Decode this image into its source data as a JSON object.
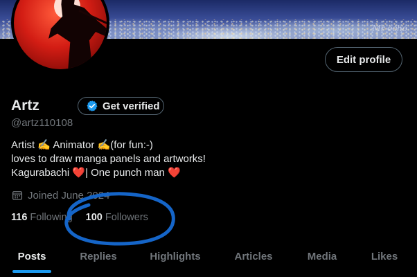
{
  "banner": {
    "signature": "Mr echo"
  },
  "profile": {
    "name": "Artz",
    "handle": "@artz110108",
    "get_verified_label": "Get verified",
    "edit_profile_label": "Edit profile",
    "bio_lines": [
      "Artist ✍️ Animator ✍️(for fun:-)",
      "loves to draw manga panels and artworks!",
      "Kagurabachi ❤️| One punch man ❤️"
    ],
    "joined": "Joined June 2024",
    "following_count": "116",
    "following_label": "Following",
    "followers_count": "100",
    "followers_label": "Followers"
  },
  "tabs": [
    {
      "label": "Posts",
      "active": true
    },
    {
      "label": "Replies",
      "active": false
    },
    {
      "label": "Highlights",
      "active": false
    },
    {
      "label": "Articles",
      "active": false
    },
    {
      "label": "Media",
      "active": false
    },
    {
      "label": "Likes",
      "active": false
    }
  ],
  "colors": {
    "accent": "#1d9bf0",
    "annotation": "#1565c8",
    "heart": "#e0245e",
    "muted": "#71767b"
  },
  "icons": {
    "verified": "verified-badge-icon",
    "calendar": "calendar-icon"
  }
}
